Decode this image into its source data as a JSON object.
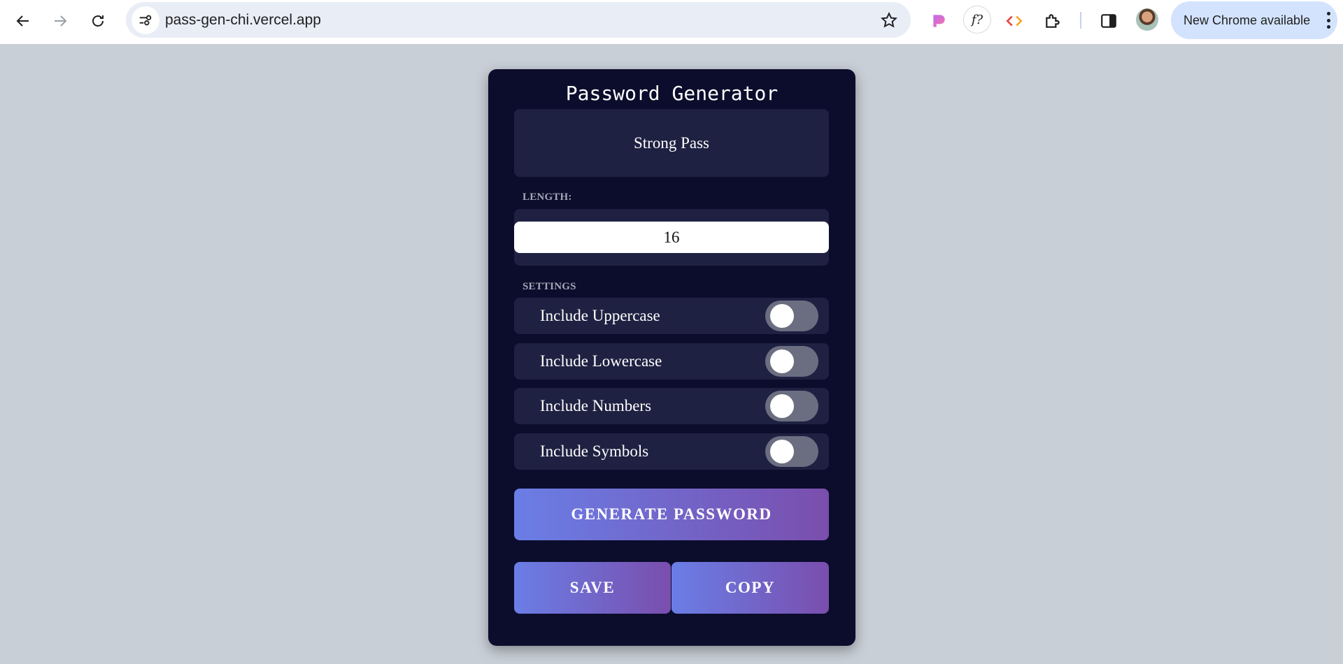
{
  "browser": {
    "url": "pass-gen-chi.vercel.app",
    "update_label": "New Chrome available",
    "ext_f_label": "f",
    "ext_f_sup": "?"
  },
  "app": {
    "title": "Password Generator",
    "result": "Strong Pass",
    "length_label": "LENGTH:",
    "length_value": "16",
    "settings_label": "SETTINGS",
    "settings": [
      {
        "label": "Include Uppercase",
        "enabled": false
      },
      {
        "label": "Include Lowercase",
        "enabled": false
      },
      {
        "label": "Include Numbers",
        "enabled": false
      },
      {
        "label": "Include Symbols",
        "enabled": false
      }
    ],
    "generate_label": "GENERATE PASSWORD",
    "save_label": "SAVE",
    "copy_label": "COPY"
  },
  "colors": {
    "page_bg": "#c8cfd7",
    "card_bg": "#0c0d2c",
    "panel_bg": "#1f2142",
    "button_gradient_start": "#6a7ee6",
    "button_gradient_end": "#7a4ead",
    "toggle_off": "#6b6e80"
  }
}
